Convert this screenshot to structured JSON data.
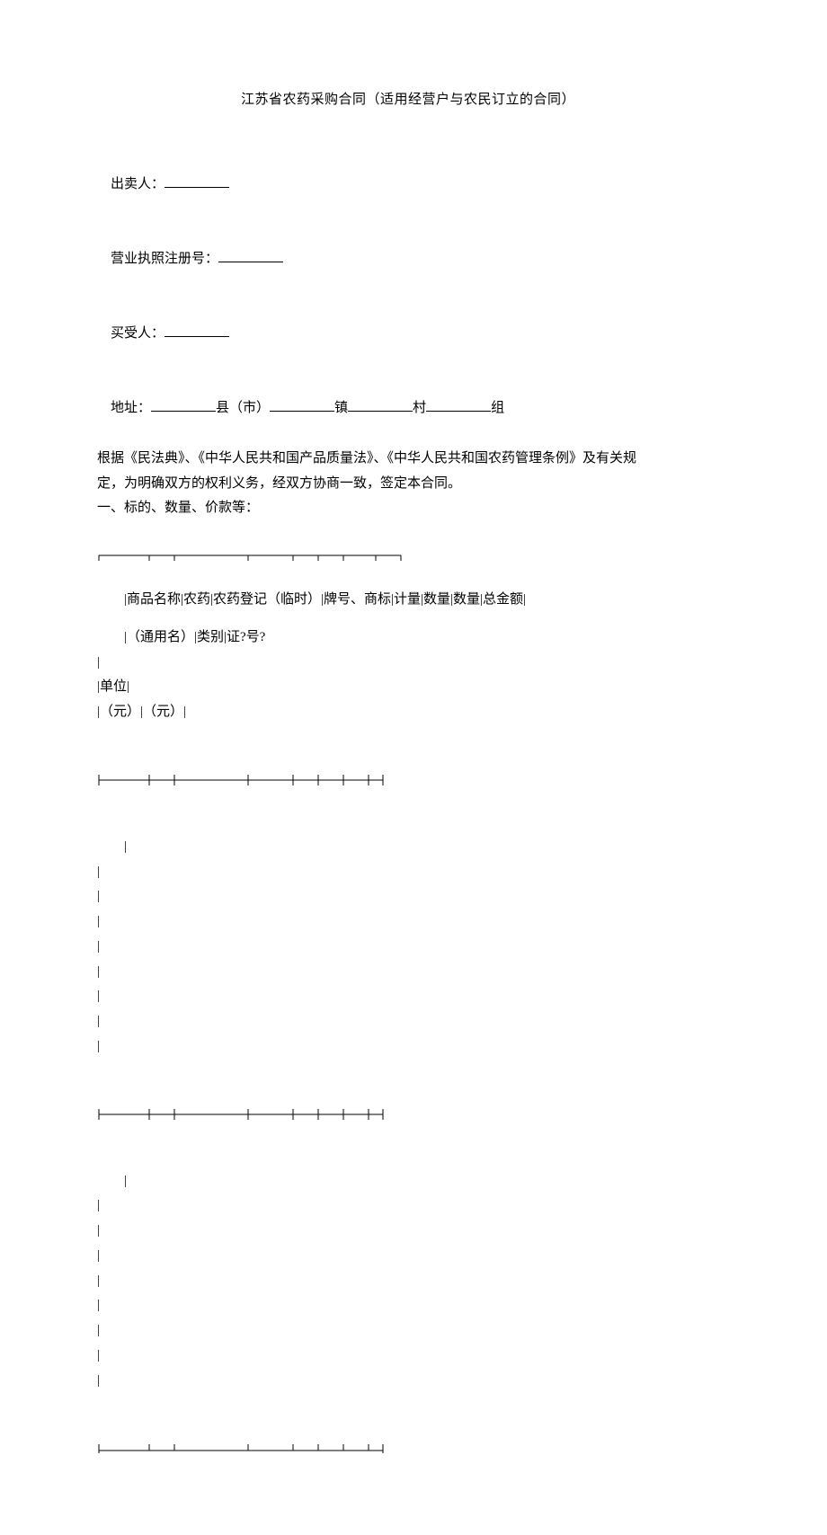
{
  "title": "江苏省农药采购合同（适用经营户与农民订立的合同）",
  "labels": {
    "seller": "出卖人：",
    "license": "营业执照注册号：",
    "buyer": "买受人：",
    "address_prefix": "地址：",
    "county_suffix": "县（市）",
    "town_suffix": "镇",
    "village_suffix": "村",
    "group_suffix": "组",
    "legal1": "根据《民法典》、《中华人民共和国产品质量法》、《中华人民共和国农药管理条例》及有关规",
    "legal2": "定，为明确双方的权利义务，经双方协商一致，签定本合同。",
    "section1": "一、标的、数量、价款等："
  },
  "table_header": {
    "row1": "|商品名称|农药|农药登记（临时）|牌号、商标|计量|数量|数量|总金额|",
    "row2_a": "|（通用名）|类别|证?号?",
    "row2_b": "|",
    "row2_c": "|单位|",
    "row2_d": "|（元）|（元）|"
  },
  "pipe": "|",
  "pipe_indent": "　|"
}
